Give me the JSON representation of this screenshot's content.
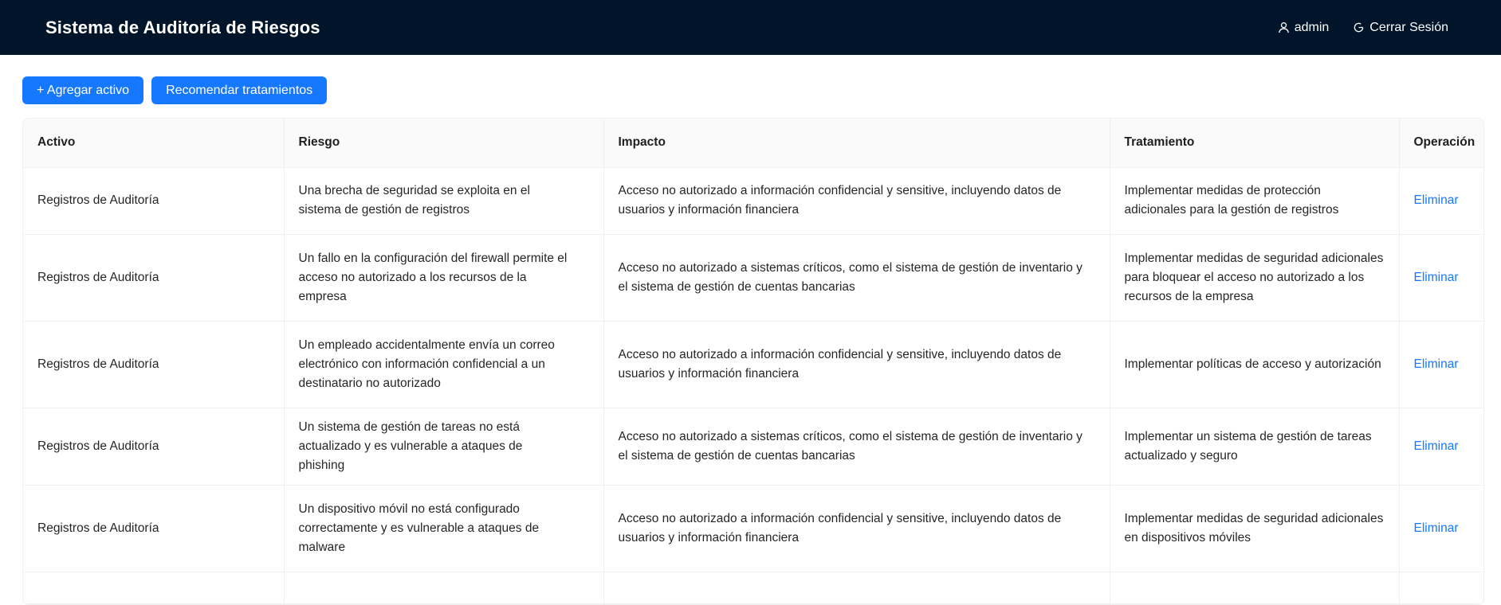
{
  "header": {
    "title": "Sistema de Auditoría de Riesgos",
    "user_label": "admin",
    "logout_label": "Cerrar Sesión",
    "user_icon": "user-icon",
    "logout_icon": "logout-icon"
  },
  "toolbar": {
    "add_label": "+ Agregar activo",
    "recommend_label": "Recomendar tratamientos"
  },
  "colors": {
    "header_bg": "#001529",
    "primary": "#1677ff"
  },
  "table": {
    "columns": [
      "Activo",
      "Riesgo",
      "Impacto",
      "Tratamiento",
      "Operación"
    ],
    "rows": [
      {
        "activo": "Registros de Auditoría",
        "riesgo": "Una brecha de seguridad se exploita en el sistema de gestión de registros",
        "impacto": "Acceso no autorizado a información confidencial y sensitive, incluyendo datos de usuarios y información financiera",
        "tratamiento": "Implementar medidas de protección adicionales para la gestión de registros",
        "operacion": "Eliminar"
      },
      {
        "activo": "Registros de Auditoría",
        "riesgo": "Un fallo en la configuración del firewall permite el acceso no autorizado a los recursos de la empresa",
        "impacto": "Acceso no autorizado a sistemas críticos, como el sistema de gestión de inventario y el sistema de gestión de cuentas bancarias",
        "tratamiento": "Implementar medidas de seguridad adicionales para bloquear el acceso no autorizado a los recursos de la empresa",
        "operacion": "Eliminar"
      },
      {
        "activo": "Registros de Auditoría",
        "riesgo": "Un empleado accidentalmente envía un correo electrónico con información confidencial a un destinatario no autorizado",
        "impacto": "Acceso no autorizado a información confidencial y sensitive, incluyendo datos de usuarios y información financiera",
        "tratamiento": "Implementar políticas de acceso y autorización",
        "operacion": "Eliminar"
      },
      {
        "activo": "Registros de Auditoría",
        "riesgo": "Un sistema de gestión de tareas no está actualizado y es vulnerable a ataques de phishing",
        "impacto": "Acceso no autorizado a sistemas críticos, como el sistema de gestión de inventario y el sistema de gestión de cuentas bancarias",
        "tratamiento": "Implementar un sistema de gestión de tareas actualizado y seguro",
        "operacion": "Eliminar"
      },
      {
        "activo": "Registros de Auditoría",
        "riesgo": "Un dispositivo móvil no está configurado correctamente y es vulnerable a ataques de malware",
        "impacto": "Acceso no autorizado a información confidencial y sensitive, incluyendo datos de usuarios y información financiera",
        "tratamiento": "Implementar medidas de seguridad adicionales en dispositivos móviles",
        "operacion": "Eliminar"
      }
    ]
  }
}
